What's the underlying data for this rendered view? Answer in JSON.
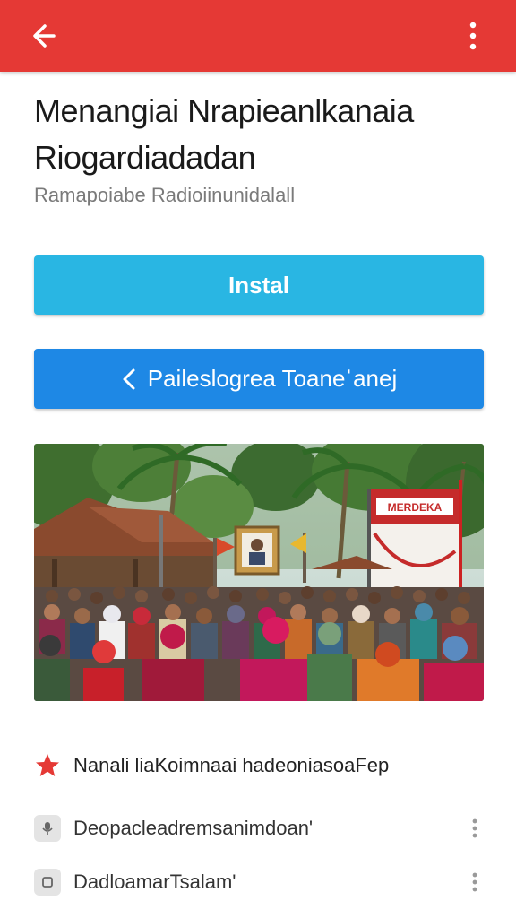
{
  "appbar": {
    "background_color": "#e53935",
    "back_icon": "arrow-left-icon",
    "more_icon": "more-vert-icon"
  },
  "header": {
    "title": "Menangiai Nrapieanlkanaia Riogardiadadan",
    "subtitle": "Ramapoiabe Radioiinunidalall"
  },
  "buttons": {
    "install_label": "Instal",
    "install_color": "#29b6e3",
    "secondary_label": "Paileslogrea Toaneˈanej",
    "secondary_color": "#1e88e5",
    "secondary_icon": "chevron-left-icon"
  },
  "hero_image": {
    "banner_text": "MERDEKA"
  },
  "feature": {
    "icon": "star-icon",
    "icon_color": "#e53935",
    "text": "Nanali liaKoimnaai hadeoniasoaFep"
  },
  "list_items": [
    {
      "icon": "microphone-icon",
      "text": "Deopacleadremsanimdoan'"
    },
    {
      "icon": "square-icon",
      "text": "DadloamarTsalam'"
    }
  ]
}
